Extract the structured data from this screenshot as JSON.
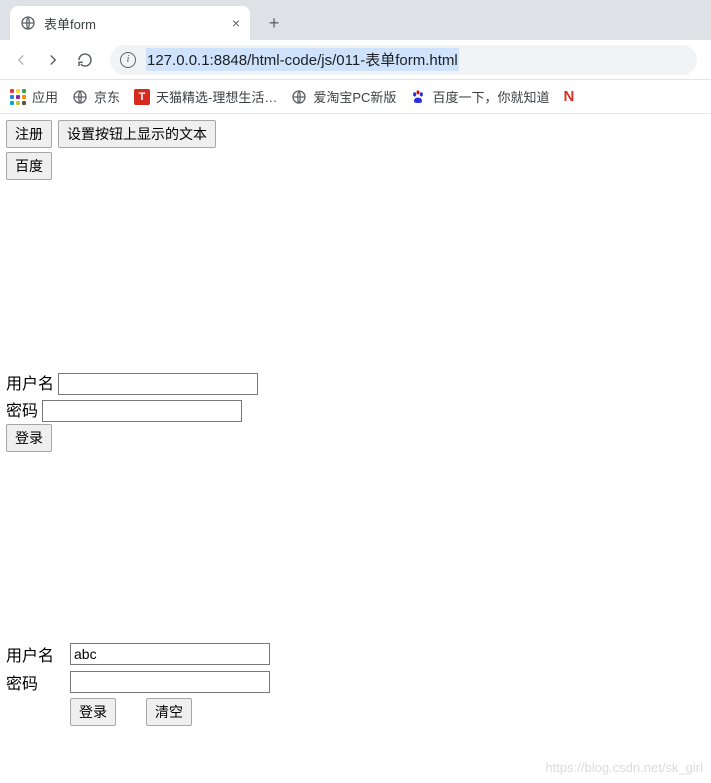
{
  "browser": {
    "tab_title": "表单form",
    "new_tab_glyph": "+",
    "close_glyph": "×",
    "info_glyph": "i",
    "url": "127.0.0.1:8848/html-code/js/011-表单form.html"
  },
  "bookmarks": {
    "apps": "应用",
    "jd": "京东",
    "tmall": "天猫精选-理想生活…",
    "atb": "爱淘宝PC新版",
    "baidu": "百度一下，你就知道",
    "cut": "N"
  },
  "buttons": {
    "register": "注册",
    "set_btn_text": "设置按钮上显示的文本",
    "baidu": "百度"
  },
  "form1": {
    "username_label": "用户名",
    "username_value": "",
    "password_label": "密码",
    "password_value": "",
    "login": "登录"
  },
  "form2": {
    "username_label": "用户名",
    "username_value": "abc",
    "password_label": "密码",
    "password_value": "",
    "login": "登录",
    "reset": "清空"
  },
  "watermark": "https://blog.csdn.net/sk_girl"
}
